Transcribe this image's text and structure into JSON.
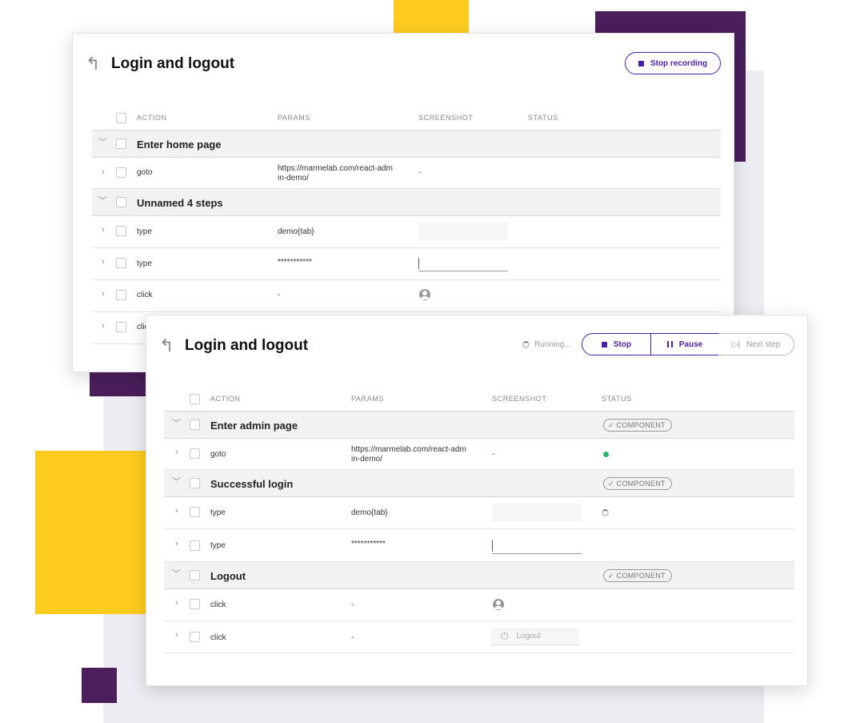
{
  "colors": {
    "accent_purple": "#4b1fa7",
    "deco_purple": "#4a1f5c",
    "deco_yellow": "#fdcc1e",
    "deco_grey": "#eeedf3",
    "success_green": "#2cb36e"
  },
  "back_panel": {
    "title": "Login and logout",
    "back_icon": "return-arrow-icon",
    "stop_recording_label": "Stop recording",
    "columns": [
      "ACTION",
      "PARAMS",
      "SCREENSHOT",
      "STATUS"
    ],
    "groups": [
      {
        "name": "Enter home page",
        "steps": [
          {
            "action": "goto",
            "params": "https://marmelab.com/react-admin-demo/",
            "screenshot": "-"
          }
        ]
      },
      {
        "name": "Unnamed 4 steps",
        "steps": [
          {
            "action": "type",
            "params": "demo{tab}",
            "screenshot": ""
          },
          {
            "action": "type",
            "params": "***********",
            "screenshot": ""
          },
          {
            "action": "click",
            "params": "-",
            "screenshot": "avatar-icon"
          },
          {
            "action": "click",
            "params": "",
            "screenshot": ""
          }
        ]
      }
    ]
  },
  "front_panel": {
    "title": "Login and logout",
    "back_icon": "return-arrow-icon",
    "running_label": "Running...",
    "stop_label": "Stop",
    "pause_label": "Pause",
    "next_step_label": "Next step",
    "columns": [
      "ACTION",
      "PARAMS",
      "SCREENSHOT",
      "STATUS"
    ],
    "component_badge": "COMPONENT",
    "groups": [
      {
        "name": "Enter admin page",
        "steps": [
          {
            "action": "goto",
            "params": "https://marmelab.com/react-admin-demo/",
            "screenshot": "-",
            "status": "success"
          }
        ]
      },
      {
        "name": "Successful login",
        "steps": [
          {
            "action": "type",
            "params": "demo{tab}",
            "screenshot": "",
            "status": "running"
          },
          {
            "action": "type",
            "params": "***********",
            "screenshot": "",
            "status": ""
          }
        ]
      },
      {
        "name": "Logout",
        "steps": [
          {
            "action": "click",
            "params": "-",
            "screenshot": "avatar-icon",
            "status": ""
          },
          {
            "action": "click",
            "params": "-",
            "screenshot": "Logout",
            "status": ""
          }
        ]
      }
    ]
  }
}
